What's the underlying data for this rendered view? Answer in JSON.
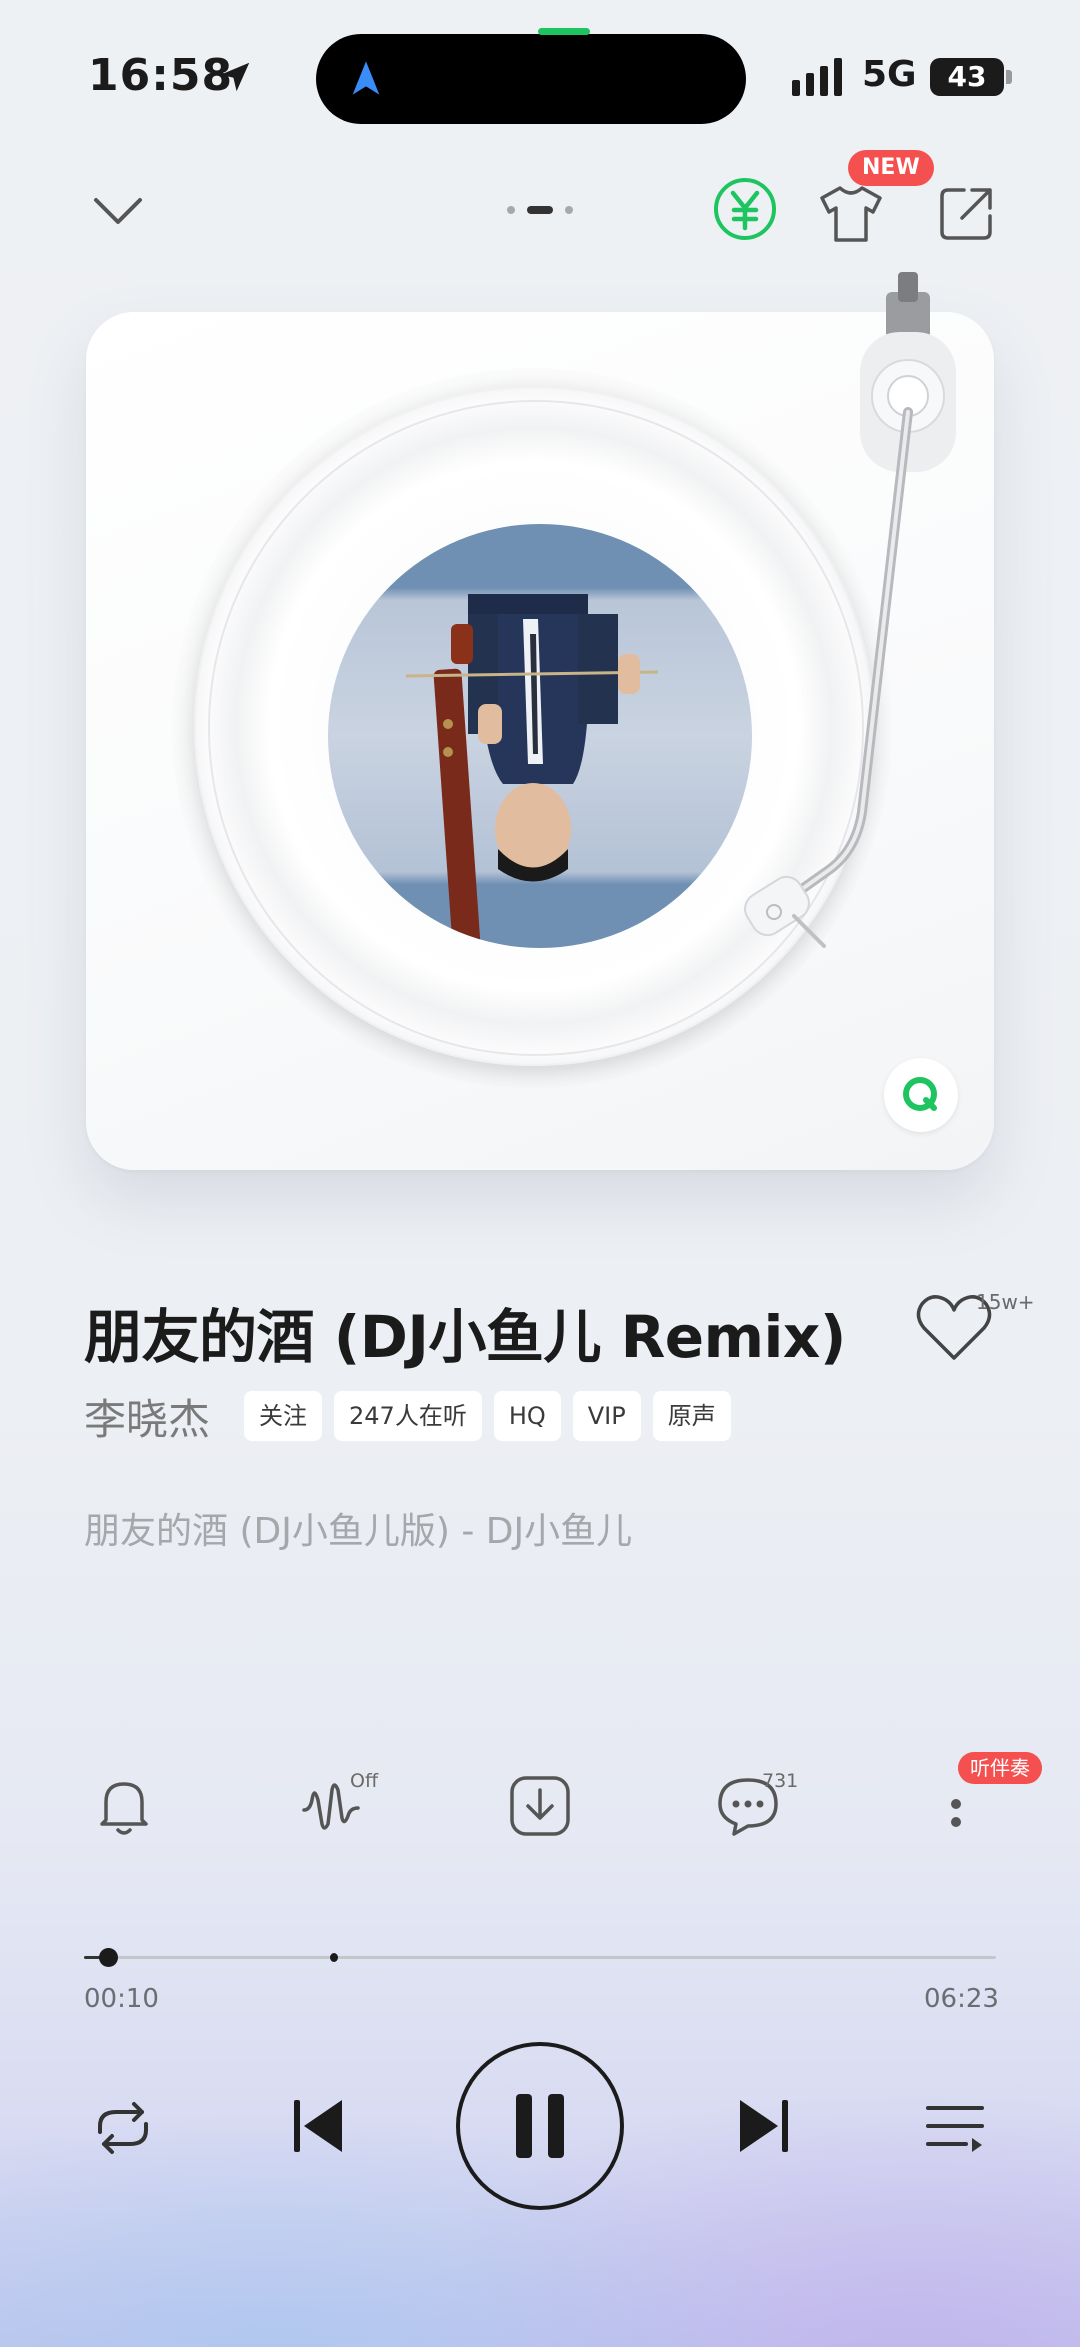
{
  "status_bar": {
    "time": "16:58",
    "network": "5G",
    "battery": "43",
    "battery_level": 0.43
  },
  "toolbar": {
    "new_badge": "NEW",
    "page_indicator": {
      "count": 3,
      "active": 1
    }
  },
  "song": {
    "title": "朋友的酒 (DJ小鱼儿 Remix)",
    "artist": "李晓杰",
    "like_count": "15w+",
    "tags": [
      "关注",
      "247人在听",
      "HQ",
      "VIP",
      "原声"
    ],
    "lyric_line": "朋友的酒 (DJ小鱼儿版) - DJ小鱼儿"
  },
  "actions": {
    "effect_state": "Off",
    "comment_count": "731",
    "more_badge": "听伴奏"
  },
  "player": {
    "current_time": "00:10",
    "total_time": "06:23",
    "progress": 0.026,
    "buffered": 0.27
  },
  "colors": {
    "accent_green": "#1dc460",
    "badge_red": "#f4504f",
    "text_dark": "#1b1b1b",
    "text_muted": "#a5a7ab"
  },
  "icons": {
    "toolbar": [
      "chevron-down-icon",
      "yuan-icon",
      "tshirt-icon",
      "share-icon"
    ],
    "actions": [
      "bell-icon",
      "audio-effect-icon",
      "download-icon",
      "comment-icon",
      "more-icon"
    ],
    "transport": [
      "repeat-icon",
      "previous-icon",
      "pause-icon",
      "next-icon",
      "playlist-icon"
    ]
  }
}
